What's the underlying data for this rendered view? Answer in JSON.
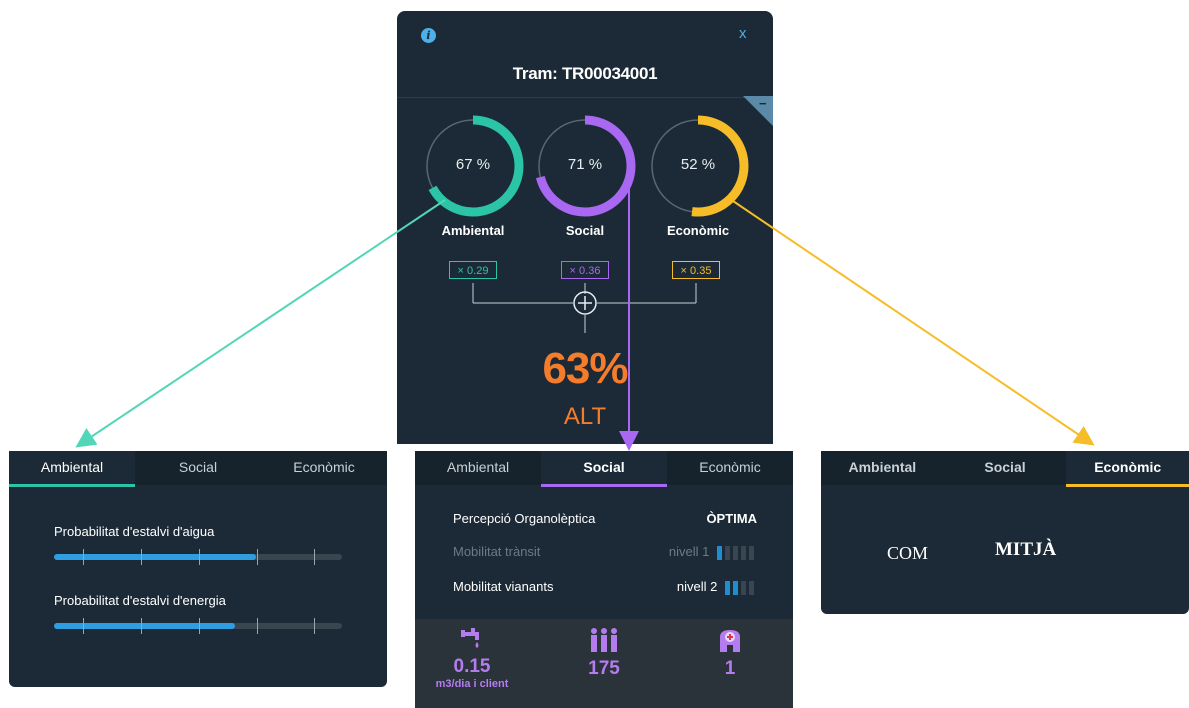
{
  "main": {
    "title": "Tram: TR00034001",
    "close": "x",
    "info": "i",
    "collapse": "−",
    "rings": [
      {
        "value": "67 %",
        "label": "Ambiental",
        "weight": "× 0.29",
        "pct": 67,
        "color": "#2bc4a7"
      },
      {
        "value": "71 %",
        "label": "Social",
        "weight": "× 0.36",
        "pct": 71,
        "color": "#a868f2"
      },
      {
        "value": "52 %",
        "label": "Econòmic",
        "weight": "× 0.35",
        "pct": 52,
        "color": "#f6bd29"
      }
    ],
    "total": "63%",
    "level": "ALT"
  },
  "ambiental_panel": {
    "tabs": [
      "Ambiental",
      "Social",
      "Econòmic"
    ],
    "bars": [
      {
        "label": "Probabilitat d'estalvi d'aigua",
        "fraction": 0.7
      },
      {
        "label": "Probabilitat d'estalvi d'energia",
        "fraction": 0.63
      }
    ]
  },
  "social_panel": {
    "tabs": [
      "Ambiental",
      "Social",
      "Econòmic"
    ],
    "rows": [
      {
        "label": "Percepció Organolèptica",
        "value": "ÒPTIMA"
      },
      {
        "label": "Mobilitat trànsit",
        "value": "nivell 1",
        "level": 1
      },
      {
        "label": "Mobilitat vianants",
        "value": "nivell 2",
        "level": 2
      }
    ],
    "stats": [
      {
        "icon": "water-tap-icon",
        "value": "0.15",
        "unit": "m3/dia i client"
      },
      {
        "icon": "people-icon",
        "value": "175",
        "unit": ""
      },
      {
        "icon": "hospital-icon",
        "value": "1",
        "unit": ""
      }
    ]
  },
  "economic_panel": {
    "tabs": [
      "Ambiental",
      "Social",
      "Econòmic"
    ],
    "label": "COM",
    "value": "MITJÀ"
  }
}
